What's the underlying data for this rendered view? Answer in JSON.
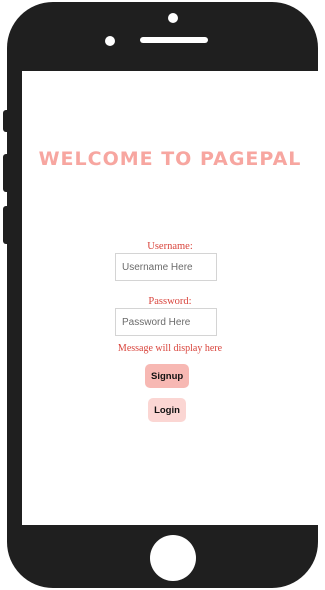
{
  "app": {
    "title": "WELCOME TO PAGEPAL"
  },
  "form": {
    "username_label": "Username:",
    "username_placeholder": "Username Here",
    "username_value": "",
    "password_label": "Password:",
    "password_placeholder": "Password Here",
    "password_value": "",
    "message": "Message will display here"
  },
  "buttons": {
    "signup_label": "Signup",
    "login_label": "Login"
  },
  "colors": {
    "accent": "#f7a6a0",
    "message": "#d9443c",
    "signup_bg": "#f7b8b3",
    "login_bg": "#fbd6d3",
    "phone_body": "#1f1f1f"
  }
}
